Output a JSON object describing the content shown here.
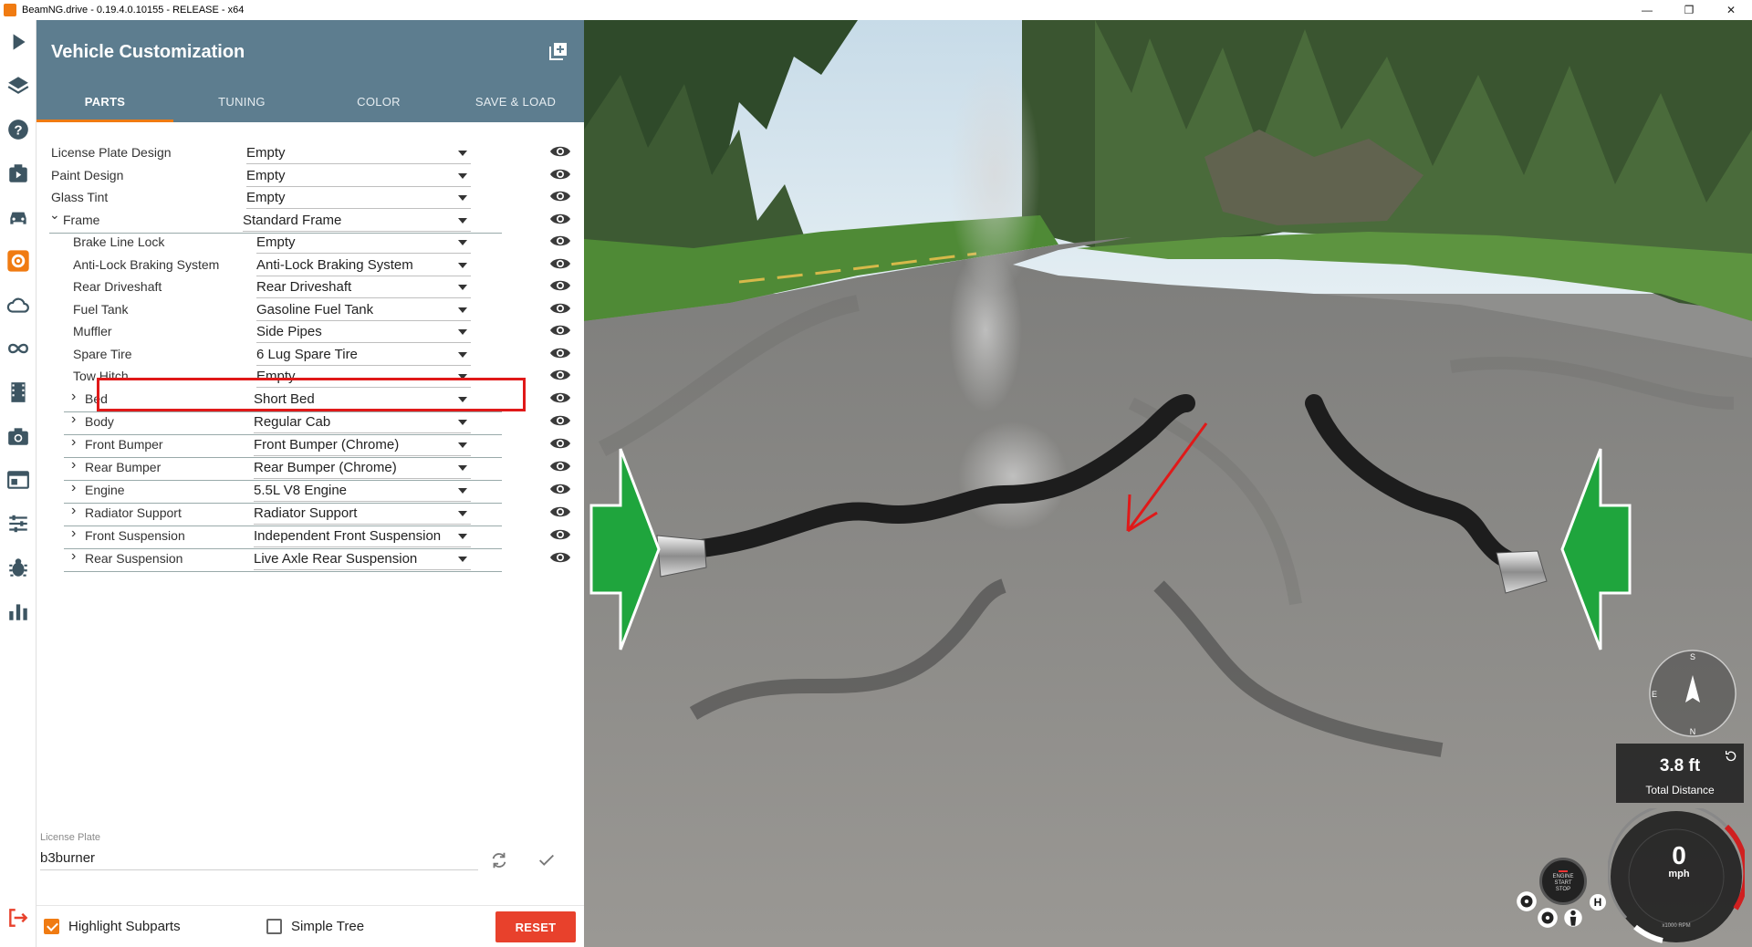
{
  "window": {
    "title": "BeamNG.drive - 0.19.4.0.10155 - RELEASE - x64",
    "controls": [
      "—",
      "❐",
      "✕"
    ]
  },
  "rail_icons": [
    "play-icon",
    "layers-icon",
    "help-icon",
    "missions-icon",
    "vehicle-icon",
    "parts-gear-icon",
    "cloud-icon",
    "flowgraph-icon",
    "film-icon",
    "camera-icon",
    "windows-icon",
    "sliders-icon",
    "bug-icon",
    "stats-icon"
  ],
  "panel": {
    "title": "Vehicle Customization",
    "tabs": [
      {
        "label": "PARTS",
        "active": true
      },
      {
        "label": "TUNING",
        "active": false
      },
      {
        "label": "COLOR",
        "active": false
      },
      {
        "label": "SAVE & LOAD",
        "active": false
      }
    ],
    "parts": [
      {
        "label": "License Plate Design",
        "value": "Empty"
      },
      {
        "label": "Paint Design",
        "value": "Empty"
      },
      {
        "label": "Glass Tint",
        "value": "Empty"
      },
      {
        "label": "Frame",
        "value": "Standard Frame"
      },
      {
        "label": "Brake Line Lock",
        "value": "Empty"
      },
      {
        "label": "Anti-Lock Braking System",
        "value": "Anti-Lock Braking System"
      },
      {
        "label": "Rear Driveshaft",
        "value": "Rear Driveshaft"
      },
      {
        "label": "Fuel Tank",
        "value": "Gasoline Fuel Tank"
      },
      {
        "label": "Muffler",
        "value": "Side Pipes"
      },
      {
        "label": "Spare Tire",
        "value": "6 Lug Spare Tire"
      },
      {
        "label": "Tow Hitch",
        "value": "Empty"
      },
      {
        "label": "Bed",
        "value": "Short Bed"
      },
      {
        "label": "Body",
        "value": "Regular Cab"
      },
      {
        "label": "Front Bumper",
        "value": "Front Bumper (Chrome)"
      },
      {
        "label": "Rear Bumper",
        "value": "Rear Bumper (Chrome)"
      },
      {
        "label": "Engine",
        "value": "5.5L V8 Engine"
      },
      {
        "label": "Radiator Support",
        "value": "Radiator Support"
      },
      {
        "label": "Front Suspension",
        "value": "Independent Front Suspension"
      },
      {
        "label": "Rear Suspension",
        "value": "Live Axle Rear Suspension"
      }
    ],
    "license_plate": {
      "caption": "License Plate",
      "value": "b3burner"
    },
    "footer": {
      "highlight_subparts": {
        "label": "Highlight Subparts",
        "checked": true
      },
      "simple_tree": {
        "label": "Simple Tree",
        "checked": false
      },
      "reset_label": "RESET"
    }
  },
  "hud": {
    "compass": {
      "top": "S",
      "left": "E",
      "bottom": "N"
    },
    "distance_value": "3.8 ft",
    "distance_label": "Total Distance",
    "speed": "0",
    "speed_unit": "mph",
    "rpm_unit": "x1000 RPM",
    "engine_button": [
      "ENGINE",
      "START",
      "STOP"
    ],
    "gear": "H"
  },
  "colors": {
    "header": "#5d7d8f",
    "accent": "#f07b12",
    "reset": "#e8412c",
    "highlight_box": "#e01919",
    "arrow_green": "#1fa53d",
    "arrow_red": "#e01919"
  }
}
